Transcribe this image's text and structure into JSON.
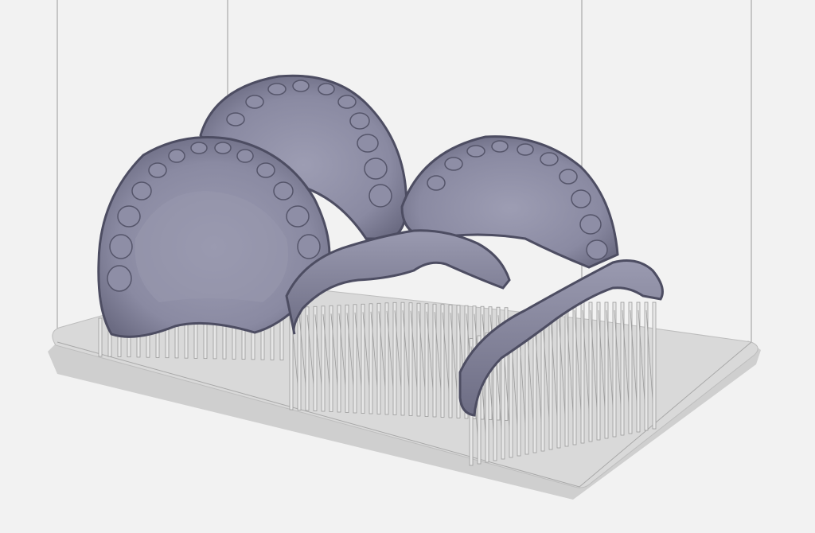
{
  "viewport": {
    "background_color": "#f2f2f2",
    "bounding_box_line_color": "#9a9a9a",
    "build_plate_top_color": "#d6d6d6",
    "build_plate_edge_color": "#c8c8c8",
    "support_color": "#e6e6e6",
    "support_edge_color": "#9c9c9c",
    "model_color": "#8c8ca4",
    "model_shadow_color": "#55556a",
    "model_highlight_color": "#b4b4ca"
  },
  "objects": [
    {
      "name": "upper-denture-left",
      "type": "upper-arch"
    },
    {
      "name": "upper-denture-back",
      "type": "upper-arch"
    },
    {
      "name": "upper-denture-right",
      "type": "upper-arch"
    },
    {
      "name": "lower-denture-center",
      "type": "lower-arch"
    },
    {
      "name": "lower-denture-front",
      "type": "lower-arch"
    }
  ]
}
